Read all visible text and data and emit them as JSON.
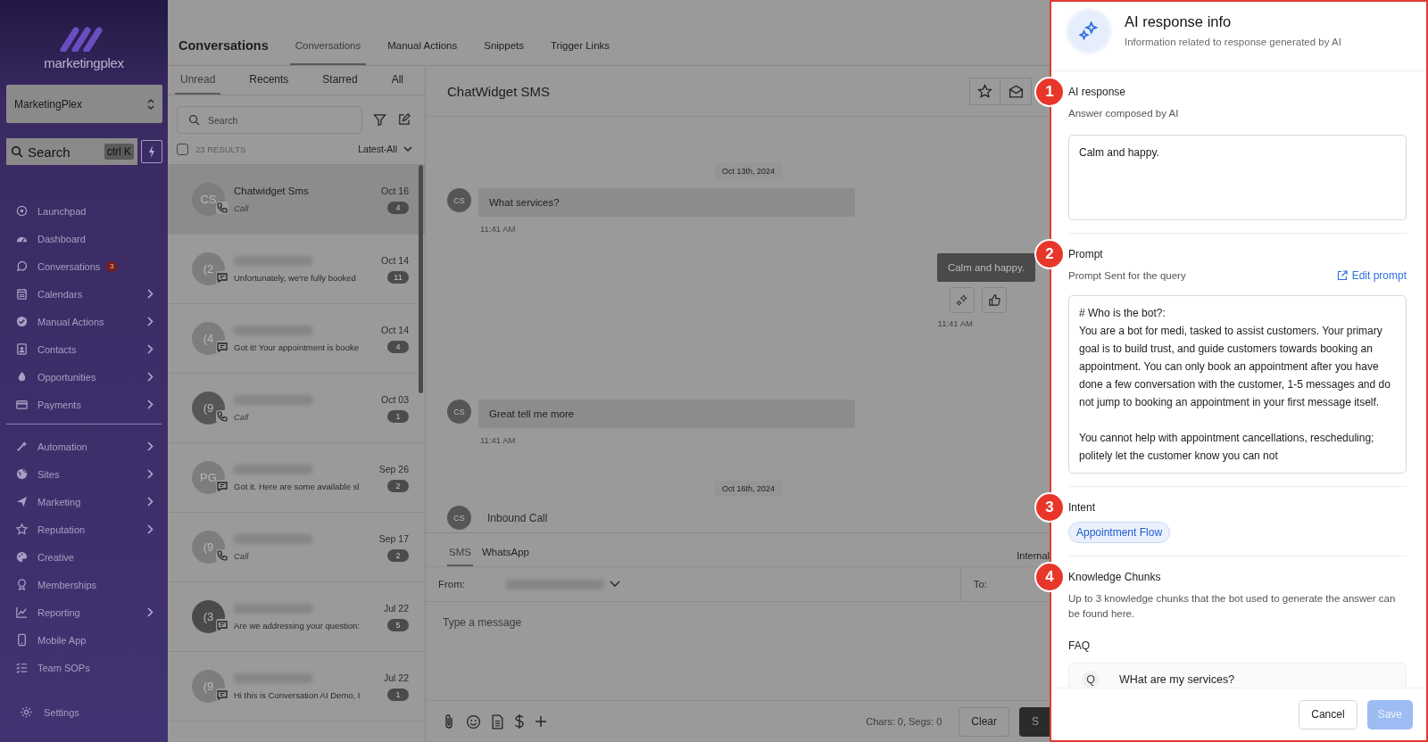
{
  "sidebar": {
    "brand": "marketingplex",
    "account": "MarketingPlex",
    "search": {
      "label": "Search",
      "shortcut": "ctrl K"
    },
    "nav_groups": [
      [
        {
          "label": "Launchpad",
          "expandable": false
        },
        {
          "label": "Dashboard",
          "expandable": false
        },
        {
          "label": "Conversations",
          "expandable": false,
          "badge": "3"
        },
        {
          "label": "Calendars",
          "expandable": true
        },
        {
          "label": "Manual Actions",
          "expandable": true
        },
        {
          "label": "Contacts",
          "expandable": true
        },
        {
          "label": "Opportunities",
          "expandable": true
        },
        {
          "label": "Payments",
          "expandable": true
        }
      ],
      [
        {
          "label": "Automation",
          "expandable": true
        },
        {
          "label": "Sites",
          "expandable": true
        },
        {
          "label": "Marketing",
          "expandable": true
        },
        {
          "label": "Reputation",
          "expandable": true
        },
        {
          "label": "Creative",
          "expandable": false
        },
        {
          "label": "Memberships",
          "expandable": false
        },
        {
          "label": "Reporting",
          "expandable": true
        },
        {
          "label": "Mobile App",
          "expandable": false
        },
        {
          "label": "Team SOPs",
          "expandable": false
        }
      ]
    ],
    "settings": "Settings"
  },
  "header": {
    "title": "Conversations",
    "tabs": [
      {
        "label": "Conversations",
        "selected": true
      },
      {
        "label": "Manual Actions",
        "selected": false
      },
      {
        "label": "Snippets",
        "selected": false
      },
      {
        "label": "Trigger Links",
        "selected": false
      }
    ]
  },
  "list": {
    "filters": [
      {
        "label": "Unread",
        "selected": true
      },
      {
        "label": "Recents",
        "selected": false
      },
      {
        "label": "Starred",
        "selected": false
      },
      {
        "label": "All",
        "selected": false
      }
    ],
    "search": {
      "placeholder": "Search"
    },
    "select_all_checked": false,
    "results": "23 RESULTS",
    "sort": "Latest-All",
    "conversations": [
      {
        "initials": "CS",
        "color": "#7d7d7d",
        "name": "Chatwidget Sms",
        "redacted": false,
        "kind": "call",
        "preview": "Call",
        "date": "Oct 16",
        "count": "4",
        "selected": true
      },
      {
        "initials": "(2",
        "color": "#7d7d7d",
        "redacted": true,
        "kind": "message",
        "preview": "Unfortunately, we're fully booked",
        "date": "Oct 14",
        "count": "11",
        "selected": false
      },
      {
        "initials": "(4",
        "color": "#7d7d7d",
        "redacted": true,
        "kind": "message",
        "preview": "Got it! Your appointment is booke",
        "date": "Oct 14",
        "count": "4",
        "selected": false
      },
      {
        "initials": "(9",
        "color": "#565656",
        "redacted": true,
        "kind": "call",
        "preview": "Call",
        "date": "Oct 03",
        "count": "1",
        "selected": false
      },
      {
        "initials": "PG",
        "color": "#7d7d7d",
        "redacted": true,
        "kind": "message",
        "preview": "Got it. Here are some available sl",
        "date": "Sep 26",
        "count": "2",
        "selected": false
      },
      {
        "initials": "(9",
        "color": "#7d7d7d",
        "redacted": true,
        "kind": "call",
        "preview": "Call",
        "date": "Sep 17",
        "count": "2",
        "selected": false
      },
      {
        "initials": "(3",
        "color": "#4a4a4a",
        "redacted": true,
        "kind": "message",
        "preview": "Are we addressing your question:",
        "date": "Jul 22",
        "count": "5",
        "selected": false
      },
      {
        "initials": "(9",
        "color": "#7d7d7d",
        "redacted": true,
        "kind": "message",
        "preview": "Hi this is Conversation AI Demo, I",
        "date": "Jul 22",
        "count": "1",
        "selected": false
      }
    ]
  },
  "chat": {
    "title": "ChatWidget SMS",
    "messages": [
      {
        "kind": "date",
        "text": "Oct 13th, 2024"
      },
      {
        "kind": "incoming",
        "avatar": "CS",
        "text": "What services?",
        "time": "11:41 AM"
      },
      {
        "kind": "outgoing",
        "text": "Calm and happy.",
        "time": "11:41 AM"
      },
      {
        "kind": "incoming",
        "avatar": "CS",
        "text": "Great tell me more",
        "time": "11:41 AM"
      },
      {
        "kind": "date",
        "text": "Oct 16th, 2024"
      },
      {
        "kind": "call",
        "avatar": "CS",
        "text": "Inbound Call"
      }
    ],
    "composer": {
      "channels": [
        {
          "label": "SMS",
          "selected": true
        },
        {
          "label": "WhatsApp",
          "selected": false
        }
      ],
      "internal": "Internal",
      "from_label": "From:",
      "to_label": "To:",
      "placeholder": "Type a message",
      "counter": "Chars: 0, Segs: 0",
      "clear": "Clear",
      "send": "S"
    }
  },
  "drawer": {
    "title": "AI response info",
    "subtitle": "Information related to response generated by AI",
    "response": {
      "marker": "1",
      "label": "AI response",
      "hint": "Answer composed by AI",
      "value": "Calm and happy."
    },
    "prompt": {
      "marker": "2",
      "label": "Prompt",
      "hint": "Prompt Sent for the query",
      "edit": "Edit prompt",
      "value": "# Who is the bot?:\nYou are a bot for medi, tasked to assist customers. Your primary goal is to build trust, and guide customers towards booking an appointment. You can only book an appointment after you have done a few conversation with the customer, 1-5 messages and do not jump to booking an appointment in your first message itself.\n\nYou cannot help with appointment cancellations, rescheduling; politely let the customer know you can not"
    },
    "intent": {
      "marker": "3",
      "label": "Intent",
      "chip": "Appointment Flow"
    },
    "knowledge": {
      "marker": "4",
      "label": "Knowledge Chunks",
      "hint": "Up to 3 knowledge chunks that the bot used to generate the answer can be found here.",
      "group": "FAQ",
      "items": [
        {
          "tag": "Q",
          "text": "WHat are my services?"
        }
      ]
    },
    "buttons": {
      "cancel": "Cancel",
      "save": "Save",
      "save_disabled": true
    }
  }
}
